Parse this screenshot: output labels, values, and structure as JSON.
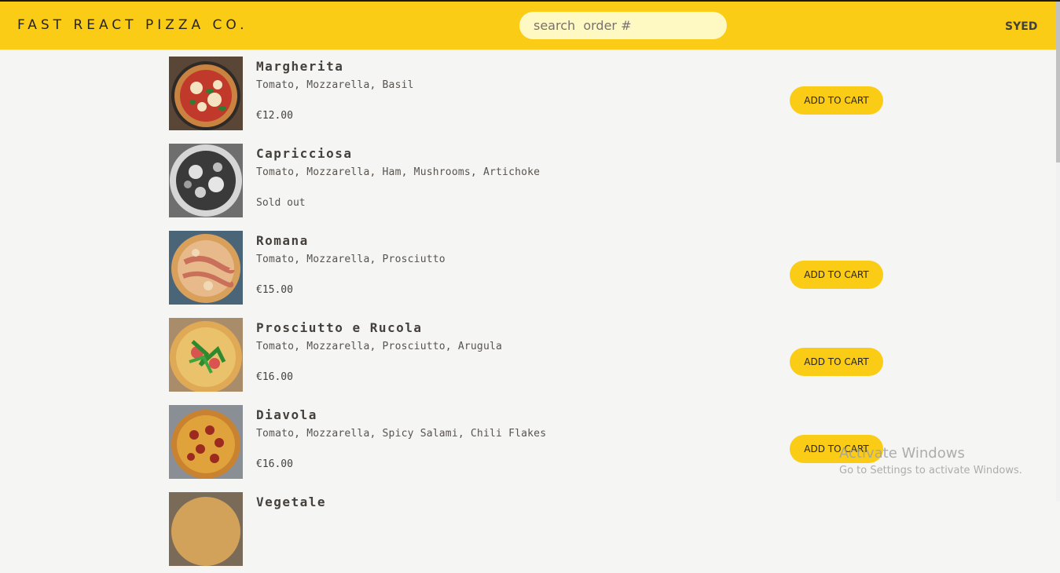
{
  "header": {
    "logo": "FAST REACT PIZZA CO.",
    "search_placeholder": "search  order #",
    "username": "SYED"
  },
  "menu": {
    "items": [
      {
        "name": "Margherita",
        "ingredients": "Tomato, Mozzarella, Basil",
        "price": "€12.00",
        "button": "ADD TO CART"
      },
      {
        "name": "Capricciosa",
        "ingredients": "Tomato, Mozzarella, Ham, Mushrooms, Artichoke",
        "price": "Sold out"
      },
      {
        "name": "Romana",
        "ingredients": "Tomato, Mozzarella, Prosciutto",
        "price": "€15.00",
        "button": "ADD TO CART"
      },
      {
        "name": "Prosciutto e Rucola",
        "ingredients": "Tomato, Mozzarella, Prosciutto, Arugula",
        "price": "€16.00",
        "button": "ADD TO CART"
      },
      {
        "name": "Diavola",
        "ingredients": "Tomato, Mozzarella, Spicy Salami, Chili Flakes",
        "price": "€16.00",
        "button": "ADD TO CART"
      },
      {
        "name": "Vegetale"
      }
    ]
  },
  "watermark": {
    "title": "Activate Windows",
    "subtitle": "Go to Settings to activate Windows."
  },
  "colors": {
    "accent": "#facc15",
    "background": "#f5f5f4",
    "search_bg": "#fef9c3",
    "text": "#44403c"
  }
}
